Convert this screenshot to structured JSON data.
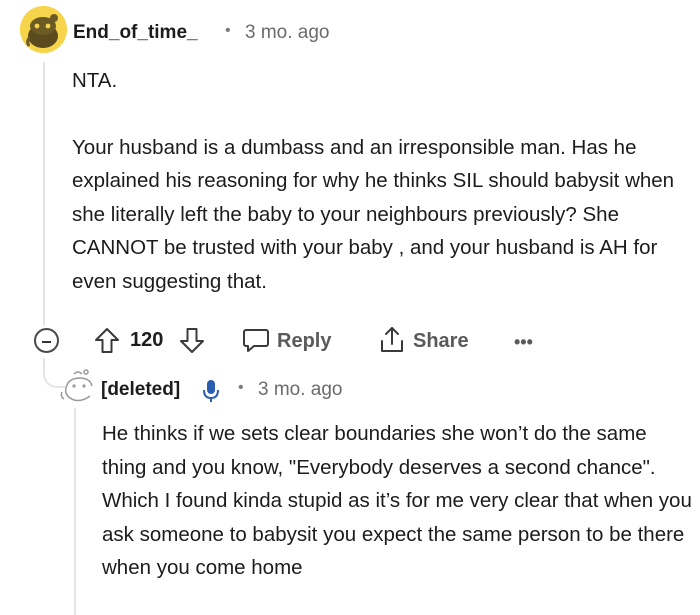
{
  "comment": {
    "author": "End_of_time_",
    "separator": "•",
    "timestamp": "3 mo. ago",
    "paragraphs": [
      "NTA.",
      "Your husband is a dumbass and an irresponsible man. Has he explained his reasoning for why he thinks SIL should babysit when she literally left the baby to your neighbours previously? She CANNOT be trusted with your baby , and your husband is AH for even suggesting that."
    ],
    "actions": {
      "score": "120",
      "reply_label": "Reply",
      "share_label": "Share",
      "more_label": "•••"
    }
  },
  "reply": {
    "author": "[deleted]",
    "separator": "•",
    "timestamp": "3 mo. ago",
    "text": "He thinks if we sets clear boundaries she won’t do the same thing and you know, \"Everybody deserves a second chance\". Which I found kinda stupid as it’s for me very clear that when you ask someone to babysit you expect the same person to be there when you come home"
  },
  "colors": {
    "avatar_bg": "#f6d44b",
    "thread_line": "#e3e6e8",
    "mic_icon": "#2a5db0"
  }
}
